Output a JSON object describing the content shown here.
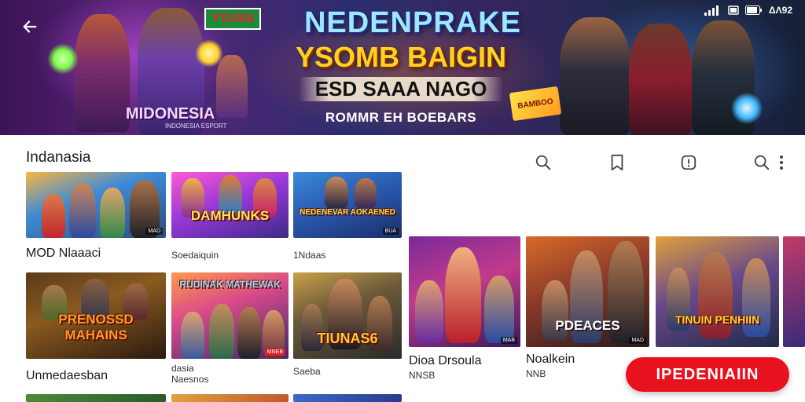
{
  "status_bar": {
    "time": "ΔΛ92"
  },
  "banner": {
    "tag": "YSVAN",
    "title": "NEDENPRAKE",
    "subtitle": "YSOMB BAIGIN",
    "line3": "ESD SAAA NAGO",
    "line4": "ROMMR EH BOEBARS",
    "left_label": "MIDONESIA",
    "left_sub": "INDONESIA ESPORT",
    "sticker": "BAMBOO"
  },
  "section": {
    "title": "Indanasia"
  },
  "grid": {
    "row1": [
      {
        "thumb_text": "",
        "badge": "MAD"
      },
      {
        "thumb_text": "DAMHUNKS",
        "badge": ""
      },
      {
        "thumb_text": "NEDENEVAR AOKAENED",
        "badge": "BUA"
      }
    ],
    "row1_labels": {
      "label_1": "MOD Nlaaaci",
      "meta_2": "Soedaiquin",
      "meta_3": "1Ndaas"
    },
    "row2": [
      {
        "thumb_text": "PRENOSSD MAHAINS",
        "badge": ""
      },
      {
        "thumb_text": "RUDINAK MATHEWAK",
        "badge": "MNEB"
      },
      {
        "thumb_text": "TIUNAS6",
        "badge": ""
      }
    ],
    "row2_labels": {
      "label_1": "Unmedaesban",
      "meta_1": "dasia",
      "meta_2": "Naesnos",
      "meta_3": "Saeba"
    },
    "wide": [
      {
        "thumb_text": "",
        "badge": "MAB"
      },
      {
        "thumb_text": "PDEACES",
        "badge": "MAD"
      },
      {
        "thumb_text": "TINUIN PENHIIN",
        "badge": ""
      }
    ],
    "wide_labels": {
      "label_1": "Dioa Drsoula",
      "meta_1": "NNSB",
      "label_2": "Noalkein",
      "meta_2": "NNB"
    }
  },
  "cta": {
    "label": "IPEDENIAIIN"
  },
  "colors": {
    "cta": "#e8121f",
    "banner_title": "#9ee7ff",
    "banner_subtitle": "#ffd21f"
  }
}
